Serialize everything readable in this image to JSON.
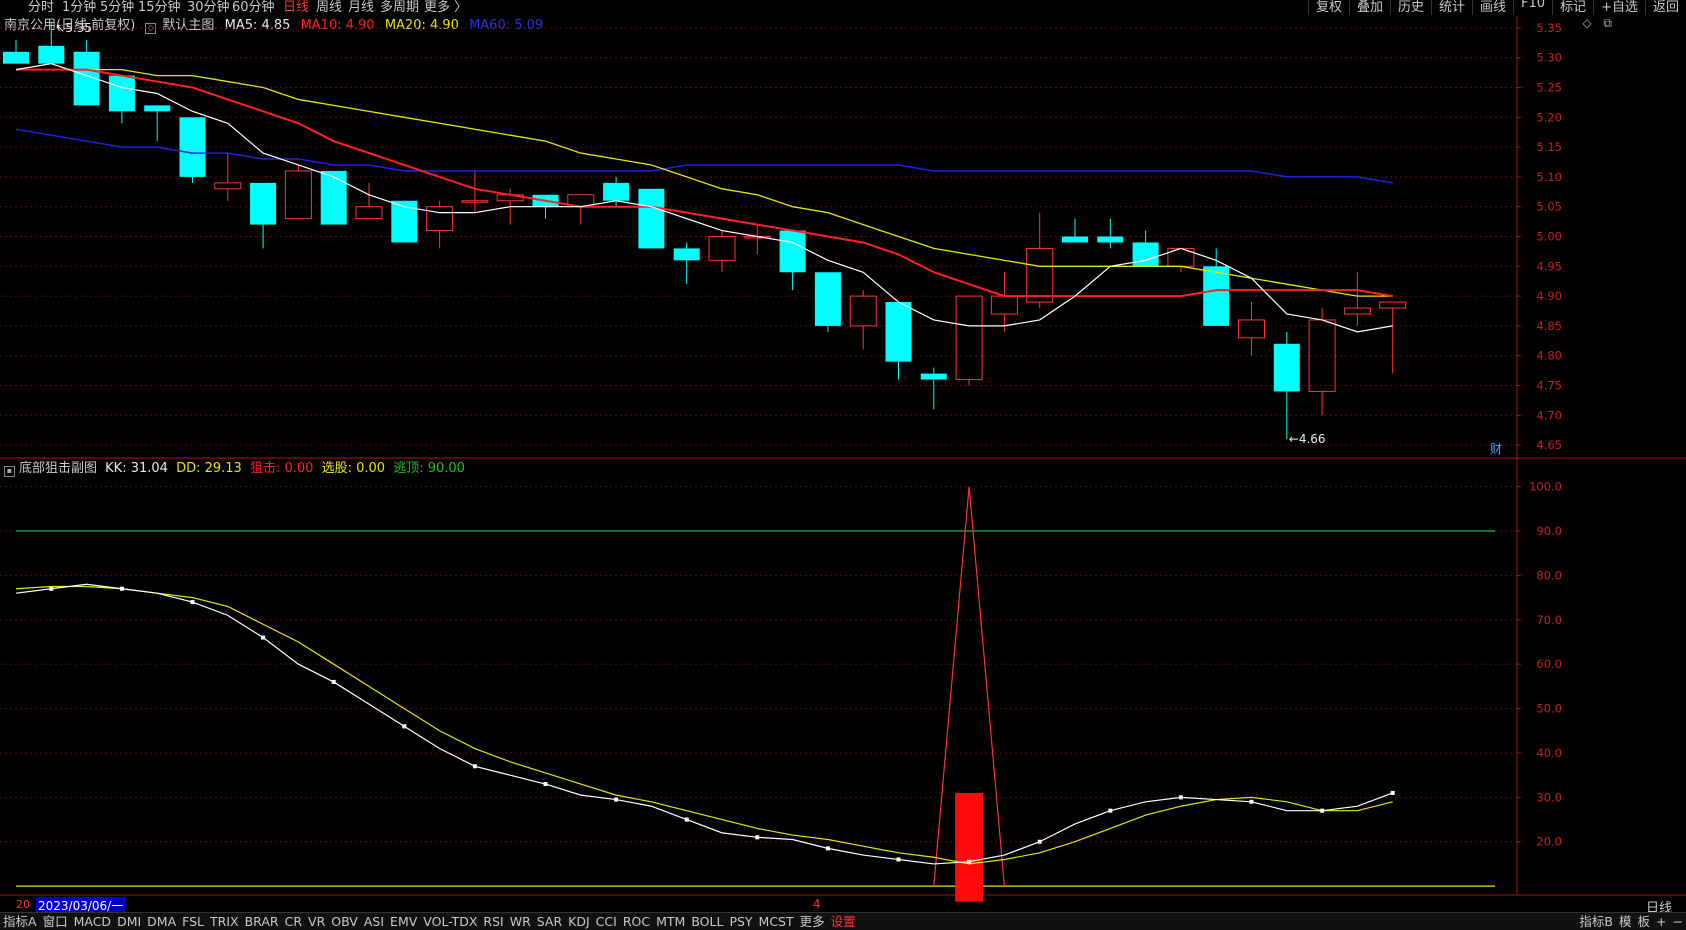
{
  "topbar": {
    "periods": [
      "分时",
      "1分钟",
      "5分钟",
      "15分钟",
      "30分钟",
      "60分钟",
      "日线",
      "周线",
      "月线",
      "多周期",
      "更多 〉"
    ],
    "active": "日线",
    "right_buttons": [
      "复权",
      "叠加",
      "历史",
      "统计",
      "画线",
      "F10",
      "标记",
      "+自选",
      "返回"
    ]
  },
  "main_legend": {
    "stock": "南京公用(日线,前复权)",
    "chart": "默认主图",
    "ma5": "MA5: 4.85",
    "ma10": "MA10: 4.90",
    "ma20": "MA20: 4.90",
    "ma60": "MA60: 5.09"
  },
  "sub_legend": {
    "name": "底部狙击副图",
    "kk": "KK: 31.04",
    "dd": "DD: 29.13",
    "zj": "狙击: 0.00",
    "xg": "选股: 0.00",
    "td": "逃顶: 90.00"
  },
  "annotations": {
    "high": "5.35",
    "low": "4.66",
    "cai": "财"
  },
  "date_bar": {
    "prefix": "20",
    "date": "2023/03/06/一",
    "mid": "4"
  },
  "period_label": "日线",
  "bottom_tabs": [
    "指标A",
    "窗口",
    "MACD",
    "DMI",
    "DMA",
    "FSL",
    "TRIX",
    "BRAR",
    "CR",
    "VR",
    "OBV",
    "ASI",
    "EMV",
    "VOL-TDX",
    "RSI",
    "WR",
    "SAR",
    "KDJ",
    "CCI",
    "ROC",
    "MTM",
    "BOLL",
    "PSY",
    "MCST",
    "更多",
    "设置"
  ],
  "bottom_right": [
    "指标B",
    "模",
    "板",
    "+",
    "−"
  ],
  "colors": {
    "up": "#ff3232",
    "down": "#00ffff",
    "ma5": "#ffffff",
    "ma10": "#ff2020",
    "ma20": "#e6e600",
    "ma60": "#2020e6",
    "axis": "#c81e1e"
  },
  "chart_data": [
    {
      "type": "candlestick",
      "title": "南京公用(日线,前复权)",
      "ylim": [
        4.63,
        5.37
      ],
      "y_ticks": [
        "5.35",
        "5.30",
        "5.25",
        "5.20",
        "5.15",
        "5.10",
        "5.05",
        "5.00",
        "4.95",
        "4.90",
        "4.85",
        "4.80",
        "4.75",
        "4.70",
        "4.65"
      ],
      "candles": [
        [
          5.31,
          5.33,
          5.29,
          5.29
        ],
        [
          5.32,
          5.36,
          5.29,
          5.29
        ],
        [
          5.31,
          5.33,
          5.22,
          5.22
        ],
        [
          5.27,
          5.27,
          5.19,
          5.21
        ],
        [
          5.22,
          5.22,
          5.16,
          5.21
        ],
        [
          5.2,
          5.2,
          5.09,
          5.1
        ],
        [
          5.08,
          5.14,
          5.06,
          5.09
        ],
        [
          5.09,
          5.09,
          4.98,
          5.02
        ],
        [
          5.03,
          5.12,
          5.03,
          5.11
        ],
        [
          5.11,
          5.11,
          5.02,
          5.02
        ],
        [
          5.03,
          5.09,
          5.03,
          5.05
        ],
        [
          5.06,
          5.06,
          4.99,
          4.99
        ],
        [
          5.01,
          5.06,
          4.98,
          5.05
        ],
        [
          5.06,
          5.11,
          5.04,
          5.06
        ],
        [
          5.06,
          5.08,
          5.02,
          5.07
        ],
        [
          5.07,
          5.07,
          5.03,
          5.05
        ],
        [
          5.05,
          5.07,
          5.02,
          5.07
        ],
        [
          5.09,
          5.1,
          5.05,
          5.06
        ],
        [
          5.08,
          5.08,
          4.98,
          4.98
        ],
        [
          4.98,
          4.99,
          4.92,
          4.96
        ],
        [
          4.96,
          5.01,
          4.94,
          5.0
        ],
        [
          5.0,
          5.02,
          4.97,
          5.0
        ],
        [
          5.01,
          5.01,
          4.91,
          4.94
        ],
        [
          4.94,
          4.94,
          4.84,
          4.85
        ],
        [
          4.85,
          4.91,
          4.81,
          4.9
        ],
        [
          4.89,
          4.89,
          4.76,
          4.79
        ],
        [
          4.77,
          4.78,
          4.71,
          4.76
        ],
        [
          4.76,
          4.9,
          4.75,
          4.9
        ],
        [
          4.87,
          4.94,
          4.84,
          4.9
        ],
        [
          4.89,
          5.04,
          4.88,
          4.98
        ],
        [
          5.0,
          5.03,
          4.99,
          4.99
        ],
        [
          5.0,
          5.03,
          4.98,
          4.99
        ],
        [
          4.99,
          5.01,
          4.95,
          4.95
        ],
        [
          4.95,
          4.98,
          4.94,
          4.98
        ],
        [
          4.95,
          4.98,
          4.85,
          4.85
        ],
        [
          4.83,
          4.89,
          4.8,
          4.86
        ],
        [
          4.82,
          4.84,
          4.66,
          4.74
        ],
        [
          4.74,
          4.88,
          4.7,
          4.86
        ],
        [
          4.87,
          4.94,
          4.85,
          4.88
        ],
        [
          4.88,
          4.89,
          4.77,
          4.89
        ]
      ],
      "ma5": [
        5.28,
        5.29,
        5.27,
        5.25,
        5.24,
        5.21,
        5.19,
        5.14,
        5.12,
        5.1,
        5.07,
        5.05,
        5.04,
        5.04,
        5.05,
        5.05,
        5.05,
        5.06,
        5.05,
        5.03,
        5.01,
        5.0,
        4.99,
        4.96,
        4.94,
        4.89,
        4.86,
        4.85,
        4.85,
        4.86,
        4.9,
        4.95,
        4.96,
        4.98,
        4.96,
        4.93,
        4.87,
        4.86,
        4.84,
        4.85
      ],
      "ma10": [
        5.28,
        5.28,
        5.28,
        5.27,
        5.26,
        5.25,
        5.23,
        5.21,
        5.19,
        5.16,
        5.14,
        5.12,
        5.1,
        5.08,
        5.07,
        5.06,
        5.05,
        5.05,
        5.05,
        5.04,
        5.03,
        5.02,
        5.01,
        5.0,
        4.99,
        4.97,
        4.94,
        4.92,
        4.9,
        4.9,
        4.9,
        4.9,
        4.9,
        4.9,
        4.91,
        4.91,
        4.91,
        4.91,
        4.91,
        4.9
      ],
      "ma20": [
        5.28,
        5.28,
        5.28,
        5.28,
        5.27,
        5.27,
        5.26,
        5.25,
        5.23,
        5.22,
        5.21,
        5.2,
        5.19,
        5.18,
        5.17,
        5.16,
        5.14,
        5.13,
        5.12,
        5.1,
        5.08,
        5.07,
        5.05,
        5.04,
        5.02,
        5.0,
        4.98,
        4.97,
        4.96,
        4.95,
        4.95,
        4.95,
        4.95,
        4.95,
        4.94,
        4.93,
        4.92,
        4.91,
        4.9,
        4.9
      ],
      "ma60": [
        5.18,
        5.17,
        5.16,
        5.15,
        5.15,
        5.14,
        5.14,
        5.13,
        5.13,
        5.12,
        5.12,
        5.11,
        5.11,
        5.11,
        5.11,
        5.11,
        5.11,
        5.11,
        5.11,
        5.12,
        5.12,
        5.12,
        5.12,
        5.12,
        5.12,
        5.12,
        5.11,
        5.11,
        5.11,
        5.11,
        5.11,
        5.11,
        5.11,
        5.11,
        5.11,
        5.11,
        5.1,
        5.1,
        5.1,
        5.09
      ]
    },
    {
      "type": "line",
      "title": "底部狙击副图",
      "ylim": [
        8,
        106
      ],
      "y_ticks": [
        "100.0",
        "90.0",
        "80.0",
        "70.0",
        "60.0",
        "50.0",
        "40.0",
        "30.0",
        "20.0"
      ],
      "kk": [
        76,
        77,
        78,
        77,
        76,
        74,
        71,
        66,
        60,
        56,
        51,
        46,
        41,
        37,
        35,
        33,
        30.5,
        29.5,
        28,
        25,
        22,
        21,
        20.5,
        18.5,
        17,
        16,
        15,
        15.5,
        17,
        20,
        24,
        27,
        29,
        30,
        29.5,
        29,
        27,
        27,
        28,
        31
      ],
      "dd": [
        77,
        77.5,
        77.5,
        77,
        76,
        75,
        73,
        69,
        65,
        60,
        55,
        50,
        45,
        41,
        38,
        35.5,
        33,
        30.5,
        29,
        27,
        25,
        23,
        21.5,
        20.5,
        19,
        17.5,
        16.5,
        15,
        16,
        17.5,
        20,
        23,
        26,
        28,
        29.5,
        30,
        29,
        27,
        27,
        29
      ],
      "zj_bar": {
        "index": 27,
        "value": 31
      },
      "zj_spike": {
        "index": 27,
        "value": 100
      },
      "xg_level": 10,
      "td_level": 90
    }
  ]
}
